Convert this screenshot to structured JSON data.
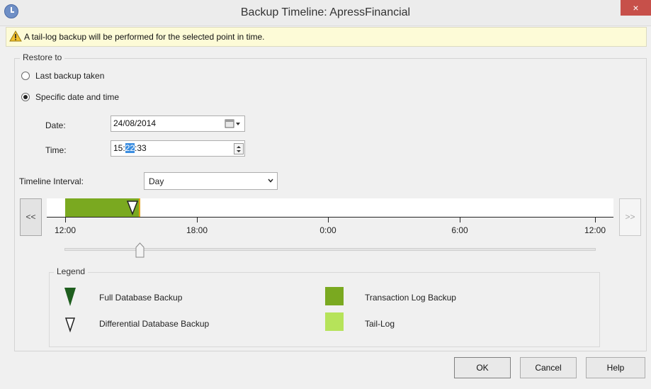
{
  "window": {
    "title": "Backup Timeline: ApressFinancial",
    "close_label": "×"
  },
  "info_bar": {
    "message": "A tail-log backup will be performed for the selected point in time."
  },
  "restore_to": {
    "caption": "Restore to",
    "option_last": "Last backup taken",
    "option_specific": "Specific date and time",
    "selected": "Specific date and time"
  },
  "date_field": {
    "label": "Date:",
    "value": "24/08/2014"
  },
  "time_field": {
    "label": "Time:",
    "value_hours": "15:",
    "value_minutes_selected": "22",
    "value_seconds": ":33"
  },
  "timeline_interval": {
    "label": "Timeline Interval:",
    "value": "Day"
  },
  "timeline": {
    "prev_label": "<<",
    "next_label": ">>",
    "tick_labels": [
      "12:00",
      "18:00",
      "0:00",
      "6:00",
      "12:00"
    ],
    "selected_position_fraction": 0.15
  },
  "legend": {
    "caption": "Legend",
    "full_db": "Full Database Backup",
    "diff_db": "Differential Database Backup",
    "tlog": "Transaction Log Backup",
    "tail_log": "Tail-Log"
  },
  "colors": {
    "transaction_log": "#7aa920",
    "tail_log": "#b6e35a",
    "full_backup_marker": "#1e5e1e",
    "selected_point": "#e4a11a"
  },
  "buttons": {
    "ok": "OK",
    "cancel": "Cancel",
    "help": "Help"
  }
}
